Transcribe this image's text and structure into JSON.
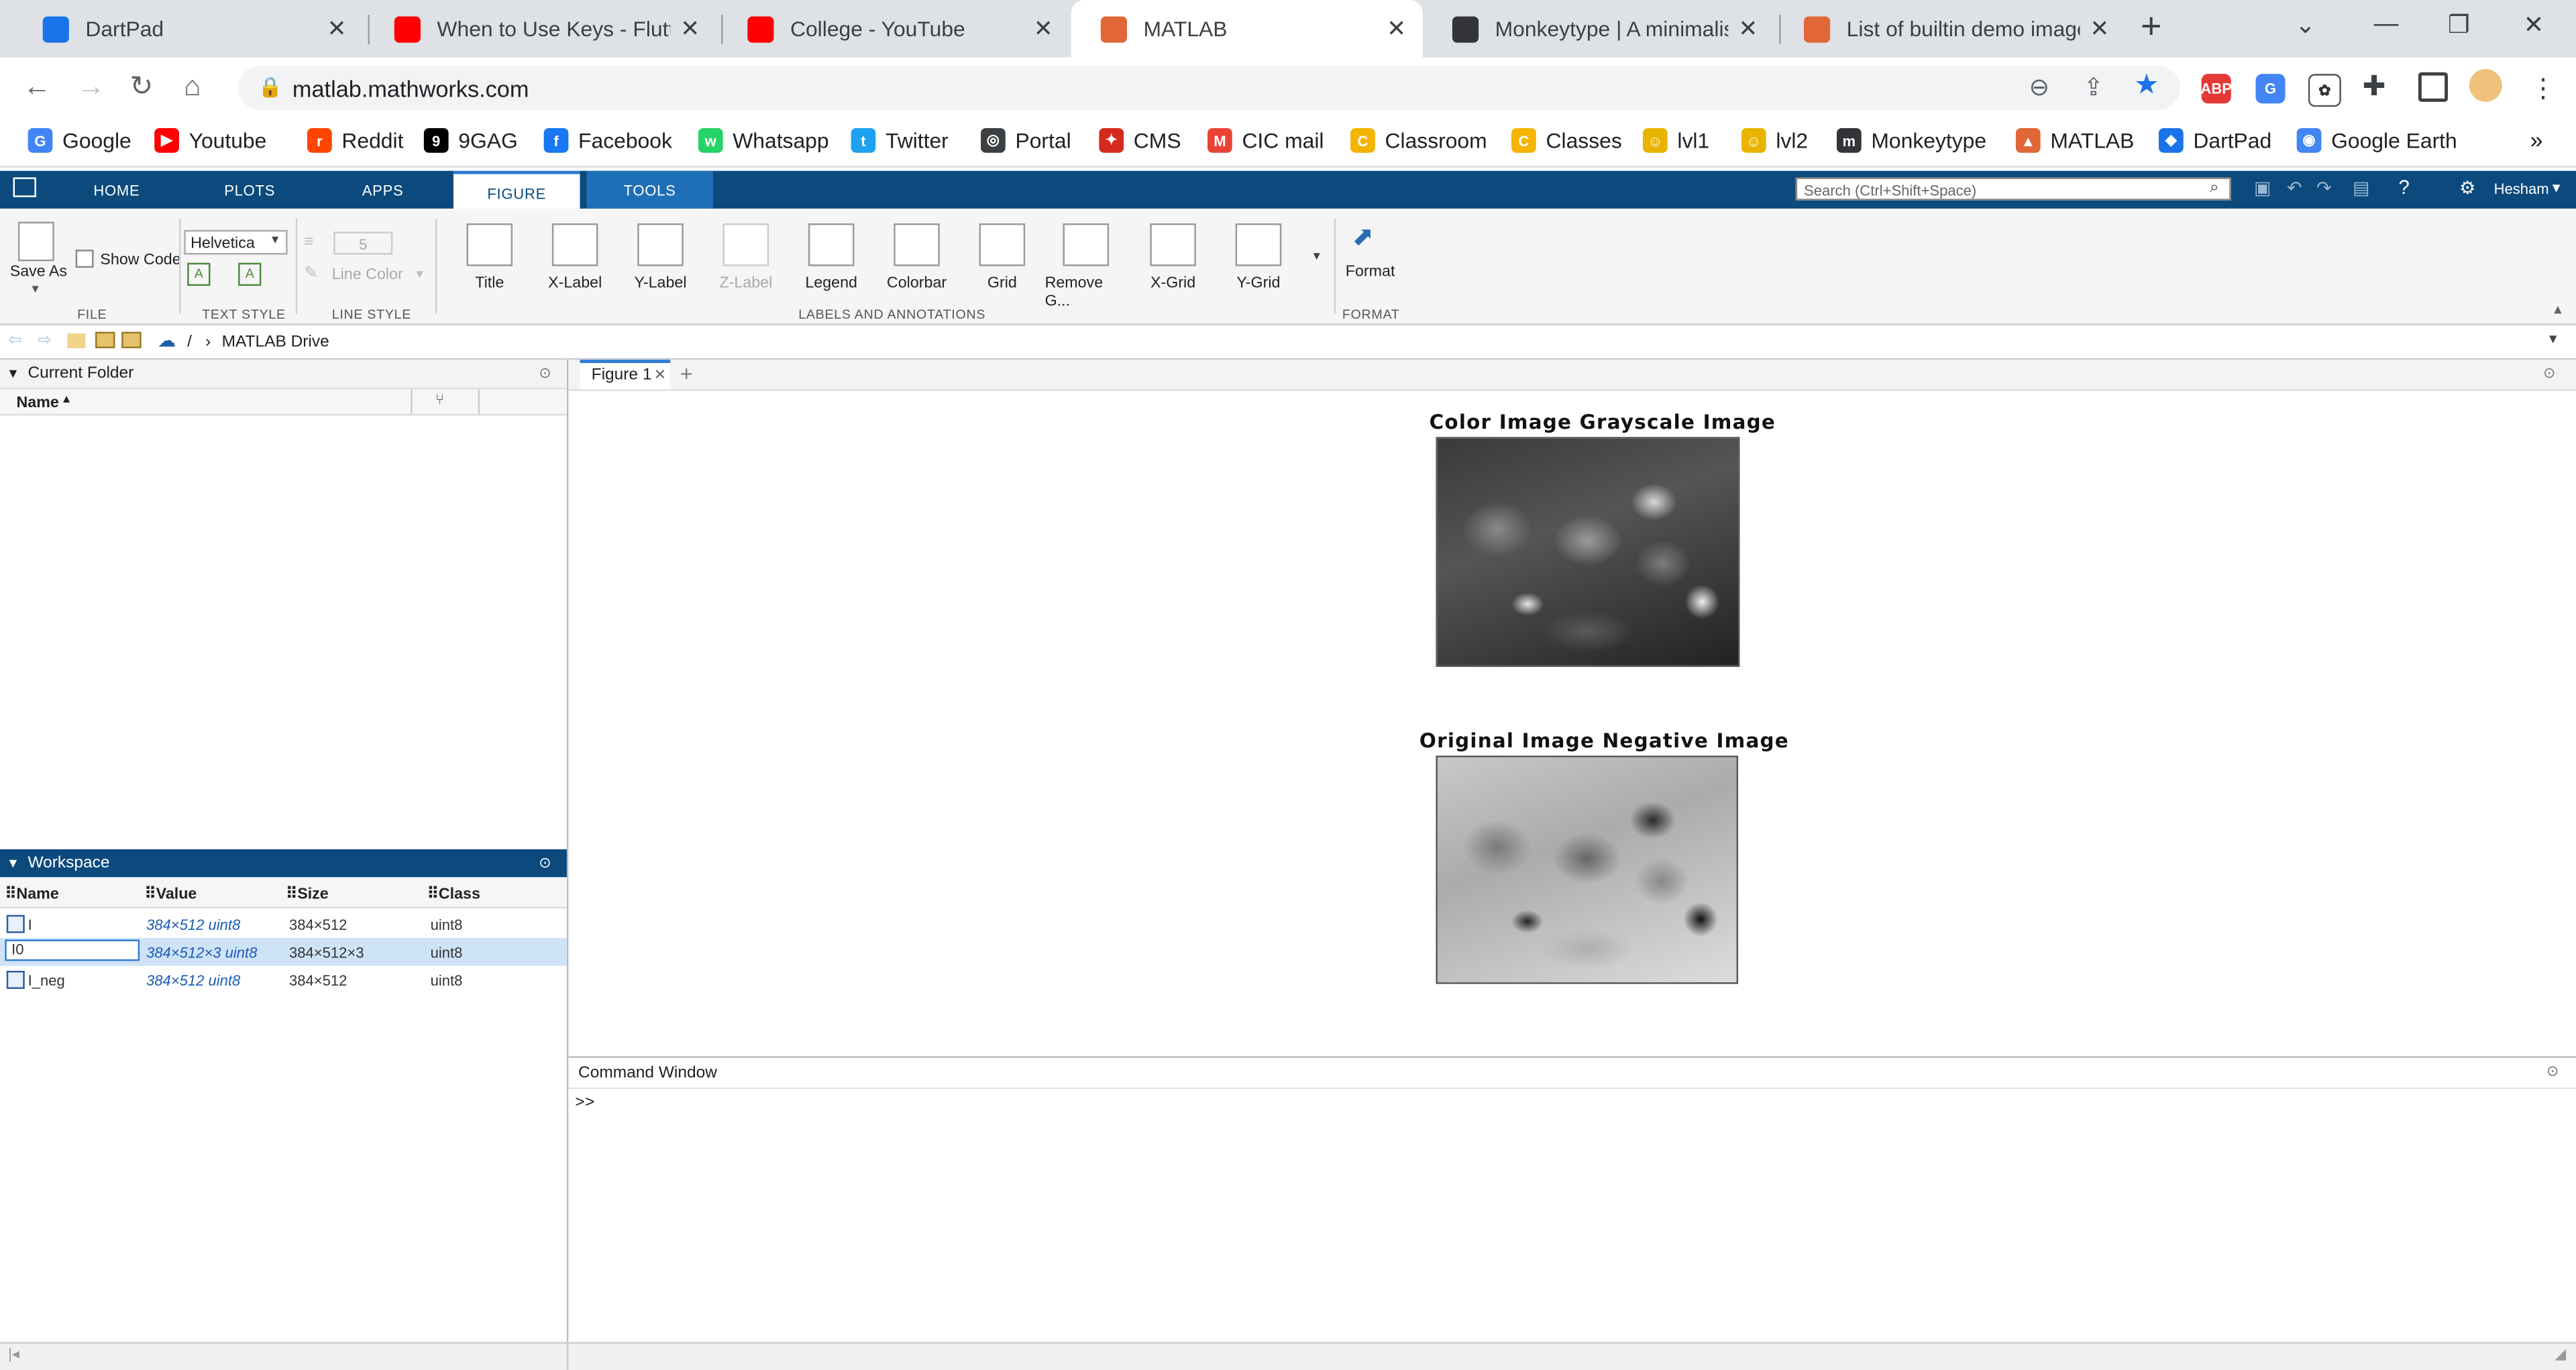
{
  "browser": {
    "tabs": [
      {
        "title": "DartPad",
        "icon": "dartpad-icon",
        "color": "#1a73e8"
      },
      {
        "title": "When to Use Keys - Flutter",
        "icon": "youtube-icon",
        "color": "#ff0000"
      },
      {
        "title": "College - YouTube",
        "icon": "youtube-icon",
        "color": "#ff0000"
      },
      {
        "title": "MATLAB",
        "icon": "matlab-icon",
        "color": "#e16737"
      },
      {
        "title": "Monkeytype | A minimalistic",
        "icon": "monkeytype-icon",
        "color": "#323437"
      },
      {
        "title": "List of builtin demo images",
        "icon": "matlab-icon",
        "color": "#e16737"
      }
    ],
    "active_tab": 3,
    "url": "matlab.mathworks.com",
    "bookmarks": [
      {
        "label": "Google",
        "color": "#4285f4",
        "glyph": "G"
      },
      {
        "label": "Youtube",
        "color": "#ff0000",
        "glyph": "▶"
      },
      {
        "label": "Reddit",
        "color": "#ff4500",
        "glyph": "r"
      },
      {
        "label": "9GAG",
        "color": "#000000",
        "glyph": "9"
      },
      {
        "label": "Facebook",
        "color": "#1877f2",
        "glyph": "f"
      },
      {
        "label": "Whatsapp",
        "color": "#25d366",
        "glyph": "w"
      },
      {
        "label": "Twitter",
        "color": "#1da1f2",
        "glyph": "t"
      },
      {
        "label": "Portal",
        "color": "#3c4043",
        "glyph": "◎"
      },
      {
        "label": "CMS",
        "color": "#d52b1e",
        "glyph": "✦"
      },
      {
        "label": "CIC mail",
        "color": "#ea4335",
        "glyph": "M"
      },
      {
        "label": "Classroom",
        "color": "#f4b400",
        "glyph": "C"
      },
      {
        "label": "Classes",
        "color": "#f4b400",
        "glyph": "C"
      },
      {
        "label": "lvl1",
        "color": "#e8b400",
        "glyph": "☺"
      },
      {
        "label": "lvl2",
        "color": "#e8b400",
        "glyph": "☺"
      },
      {
        "label": "Monkeytype",
        "color": "#323437",
        "glyph": "m"
      },
      {
        "label": "MATLAB",
        "color": "#e16737",
        "glyph": "▲"
      },
      {
        "label": "DartPad",
        "color": "#1a73e8",
        "glyph": "◆"
      },
      {
        "label": "Google Earth",
        "color": "#4285f4",
        "glyph": "◉"
      }
    ],
    "more_bookmarks": "»"
  },
  "toolstrip": {
    "tabs": [
      "HOME",
      "PLOTS",
      "APPS",
      "FIGURE",
      "TOOLS"
    ],
    "active_tab": "FIGURE",
    "search_placeholder": "Search (Ctrl+Shift+Space)",
    "user": "Hesham",
    "file": {
      "save_as": "Save As",
      "show_code": "Show Code",
      "group": "FILE"
    },
    "text_style": {
      "font": "Helvetica",
      "group": "TEXT STYLE"
    },
    "line_style": {
      "width": "5",
      "line_color": "Line Color",
      "group": "LINE STYLE"
    },
    "annotations": {
      "buttons": [
        "Title",
        "X-Label",
        "Y-Label",
        "Z-Label",
        "Legend",
        "Colorbar",
        "Grid",
        "Remove G...",
        "X-Grid",
        "Y-Grid"
      ],
      "disabled": [
        "Z-Label"
      ],
      "group": "LABELS AND ANNOTATIONS"
    },
    "format": {
      "label": "Format",
      "group": "FORMAT"
    }
  },
  "path": {
    "root": "/",
    "sep": "›",
    "folder": "MATLAB Drive"
  },
  "current_folder": {
    "title": "Current Folder",
    "column_name": "Name"
  },
  "workspace": {
    "title": "Workspace",
    "columns": [
      "Name",
      "Value",
      "Size",
      "Class"
    ],
    "rows": [
      {
        "name": "I",
        "value": "384×512 uint8",
        "size": "384×512",
        "class": "uint8"
      },
      {
        "name": "I0",
        "value": "384×512×3 uint8",
        "size": "384×512×3",
        "class": "uint8"
      },
      {
        "name": "I_neg",
        "value": "384×512 uint8",
        "size": "384×512",
        "class": "uint8"
      }
    ],
    "selected_row": 1
  },
  "figure": {
    "tab": "Figure 1",
    "add_tab": "+",
    "titles": [
      "Color Image Grayscale Image",
      "Original Image Negative Image"
    ]
  },
  "command_window": {
    "title": "Command Window",
    "prompt": ">>"
  }
}
